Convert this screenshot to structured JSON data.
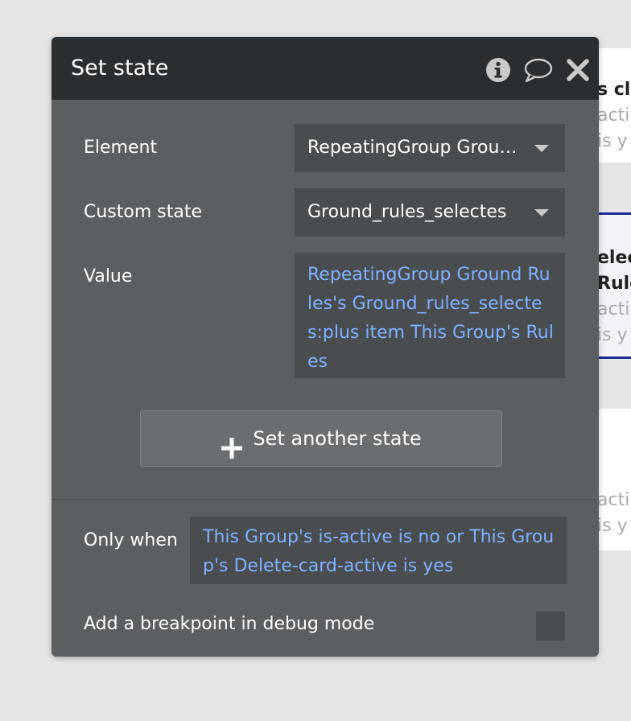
{
  "background_cards": [
    {
      "lines": [
        "s cl",
        "acti",
        " is y"
      ]
    },
    {
      "lines": [
        "elec",
        "Rule",
        "acti",
        " is y"
      ]
    },
    {
      "lines": [
        "acti",
        " is y"
      ]
    }
  ],
  "panel": {
    "title": "Set state",
    "header_icons": [
      "info-icon",
      "comment-icon",
      "close-icon"
    ],
    "element": {
      "label": "Element",
      "value": "RepeatingGroup Ground Rules"
    },
    "custom_state": {
      "label": "Custom state",
      "value": "Ground_rules_selectes"
    },
    "value": {
      "label": "Value",
      "expression": "RepeatingGroup Ground Rules's Ground_rules_selectes:plus item This Group's Rules"
    },
    "add_button": {
      "label": "Set another state",
      "icon": "plus-icon"
    },
    "only_when": {
      "label": "Only when",
      "expression": "This Group's is-active is no or This Group's Delete-card-active is yes"
    },
    "breakpoint": {
      "label": "Add a breakpoint in debug mode",
      "checked": false
    }
  },
  "colors": {
    "panel_bg": "#5b5f62",
    "header_bg": "#2a2e30",
    "field_bg": "#4a4d50",
    "expression_text": "#7fb1ff",
    "selected_card_border": "#1b2c8f"
  }
}
